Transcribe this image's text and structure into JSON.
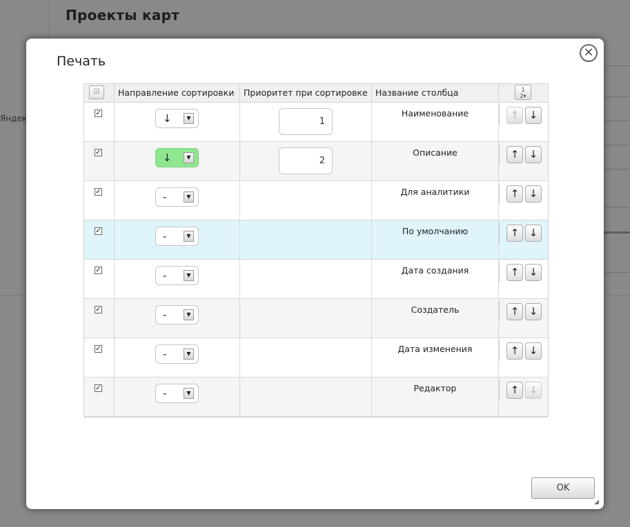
{
  "background": {
    "page_title": "Проекты карт",
    "side_text": "Яндек"
  },
  "dialog": {
    "title": "Печать",
    "close_glyph": "✕",
    "ok_label": "OK"
  },
  "table": {
    "headers": {
      "select_all_glyph": "☑",
      "direction": "Направление сортировки",
      "priority": "Приоритет при сортировке",
      "name": "Название столбца",
      "sort_glyph": "1\n2▾"
    },
    "rows": [
      {
        "checked": "✓",
        "direction": "↓",
        "direction_active": false,
        "priority": "1",
        "name": "Наименование",
        "up": "↑",
        "down": "↓",
        "up_enabled": false,
        "down_enabled": true
      },
      {
        "checked": "✓",
        "direction": "↓",
        "direction_active": true,
        "priority": "2",
        "name": "Описание",
        "up": "↑",
        "down": "↓",
        "up_enabled": true,
        "down_enabled": true
      },
      {
        "checked": "✓",
        "direction": "-",
        "direction_active": false,
        "priority": "",
        "name": "Для аналитики",
        "up": "↑",
        "down": "↓",
        "up_enabled": true,
        "down_enabled": true
      },
      {
        "checked": "✓",
        "direction": "-",
        "direction_active": false,
        "priority": "",
        "name": "По умолчанию",
        "up": "↑",
        "down": "↓",
        "up_enabled": true,
        "down_enabled": true
      },
      {
        "checked": "✓",
        "direction": "-",
        "direction_active": false,
        "priority": "",
        "name": "Дата создания",
        "up": "↑",
        "down": "↓",
        "up_enabled": true,
        "down_enabled": true
      },
      {
        "checked": "✓",
        "direction": "-",
        "direction_active": false,
        "priority": "",
        "name": "Создатель",
        "up": "↑",
        "down": "↓",
        "up_enabled": true,
        "down_enabled": true
      },
      {
        "checked": "✓",
        "direction": "-",
        "direction_active": false,
        "priority": "",
        "name": "Дата изменения",
        "up": "↑",
        "down": "↓",
        "up_enabled": true,
        "down_enabled": true
      },
      {
        "checked": "✓",
        "direction": "-",
        "direction_active": false,
        "priority": "",
        "name": "Редактор",
        "up": "↑",
        "down": "↓",
        "up_enabled": true,
        "down_enabled": false
      }
    ],
    "selected_row_index": 3
  },
  "colors": {
    "active_direction": "#8ee78e",
    "selected_row": "#dff4fb"
  }
}
